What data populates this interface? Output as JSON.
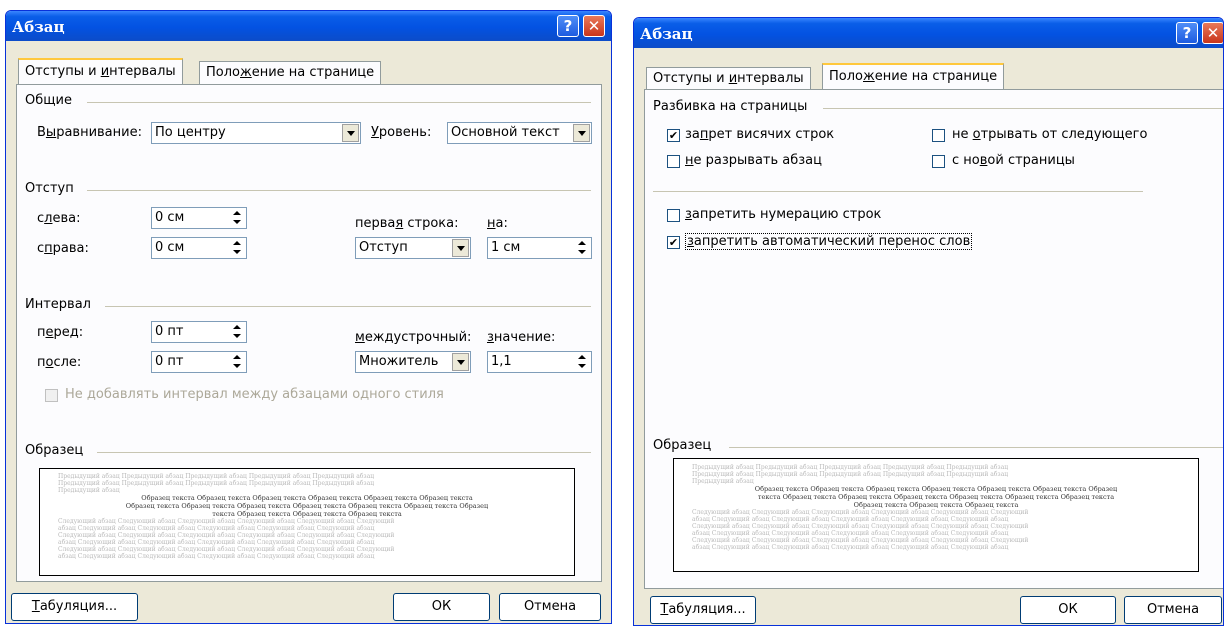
{
  "colors": {
    "titlebar": "#0352e2",
    "dialog_bg": "#ece9d8",
    "active_tab_highlight": "#ffc83c",
    "close_button": "#c8351b"
  },
  "dialog1": {
    "title": "Абзац",
    "help_button": "?",
    "close_button": "✕",
    "tabs": [
      {
        "pre": "Отступы и ",
        "accel": "и",
        "post": "нтервалы"
      },
      {
        "pre": "Поло",
        "accel": "ж",
        "post": "ение на странице"
      }
    ],
    "general": {
      "heading": "Общие",
      "align_label_pre": "В",
      "align_label_accel": "ы",
      "align_label_post": "равнивание:",
      "align_value": "По центру",
      "level_label_accel": "У",
      "level_label_post": "ровень:",
      "level_value": "Основной текст"
    },
    "indent": {
      "heading": "Отступ",
      "left_label_pre": "с",
      "left_label_accel": "л",
      "left_label_post": "ева:",
      "left_value": "0 см",
      "right_label_pre": "с",
      "right_label_accel": "п",
      "right_label_post": "рава:",
      "right_value": "0 см",
      "first_line_label_pre": "перва",
      "first_line_label_accel": "я",
      "first_line_label_post": " строка:",
      "first_line_value": "Отступ",
      "by_label_accel": "н",
      "by_label_post": "а:",
      "by_value": "1 см"
    },
    "spacing": {
      "heading": "Интервал",
      "before_label_pre": "п",
      "before_label_accel": "е",
      "before_label_post": "ред:",
      "before_value": "0 пт",
      "after_label_pre": "п",
      "after_label_accel": "о",
      "after_label_post": "сле:",
      "after_value": "0 пт",
      "line_label_accel": "м",
      "line_label_post": "еждустрочный:",
      "line_value": "Множитель",
      "at_label_accel": "з",
      "at_label_post": "начение:",
      "at_value": "1,1",
      "no_space_label": "Не добавлять интервал между абзацами одного стиля"
    },
    "preview": {
      "heading": "Образец",
      "prev_lines": [
        "Предыдущий абзац Предыдущий абзац Предыдущий абзац Предыдущий абзац Предыдущий абзац",
        "Предыдущий абзац Предыдущий абзац Предыдущий абзац Предыдущий абзац Предыдущий абзац",
        "Предыдущий абзац"
      ],
      "sample_lines": [
        "Образец текста Образец текста Образец текста Образец текста Образец текста Образец текста",
        "Образец текста Образец текста Образец текста Образец текста Образец текста Образец текста Образец",
        "текста Образец текста Образец текста Образец текста"
      ],
      "next_lines": [
        "Следующий абзац Следующий абзац Следующий абзац Следующий абзац Следующий абзац Следующий",
        "абзац Следующий абзац Следующий абзац Следующий абзац Следующий абзац Следующий абзац",
        "Следующий абзац Следующий абзац Следующий абзац Следующий абзац Следующий абзац Следующий",
        "абзац Следующий абзац Следующий абзац Следующий абзац Следующий абзац Следующий абзац",
        "Следующий абзац Следующий абзац Следующий абзац Следующий абзац Следующий абзац Следующий",
        "абзац Следующий абзац Следующий абзац Следующий абзац Следующий абзац Следующий абзац"
      ]
    },
    "buttons": {
      "tabs_accel": "Т",
      "tabs_post": "абуляция...",
      "ok": "ОК",
      "cancel": "Отмена"
    }
  },
  "dialog2": {
    "title": "Абзац",
    "help_button": "?",
    "close_button": "✕",
    "tabs": [
      {
        "pre": "Отступы и ",
        "accel": "и",
        "post": "нтервалы"
      },
      {
        "pre": "Поло",
        "accel": "ж",
        "post": "ение на странице"
      }
    ],
    "pagination": {
      "heading": "Разбивка на страницы",
      "widow_pre": "за",
      "widow_accel": "п",
      "widow_post": "рет висячих строк",
      "widow_checked": "✔",
      "keep_next_pre": "не ",
      "keep_next_accel": "о",
      "keep_next_post": "трывать от следующего",
      "keep_together_accel": "н",
      "keep_together_post": "е разрывать абзац",
      "page_break_pre": "с но",
      "page_break_accel": "в",
      "page_break_post": "ой страницы"
    },
    "suppress_line_numbers_accel": "з",
    "suppress_line_numbers_post": "апретить нумерацию строк",
    "no_hyphenation_accel": "з",
    "no_hyphenation_post": "апретить автоматический перенос слов",
    "no_hyphenation_checked": "✔",
    "preview": {
      "heading": "Образец",
      "prev_lines": [
        "Предыдущий абзац Предыдущий абзац Предыдущий абзац Предыдущий абзац Предыдущий абзац",
        "Предыдущий абзац Предыдущий абзац Предыдущий абзац Предыдущий абзац Предыдущий абзац",
        "Предыдущий абзац"
      ],
      "sample_lines": [
        "Образец текста Образец текста Образец текста Образец текста Образец текста Образец текста Образец",
        "текста Образец текста Образец текста Образец текста Образец текста Образец текста Образец текста",
        "Образец текста Образец текста Образец текста"
      ],
      "next_lines": [
        "Следующий абзац Следующий абзац Следующий абзац Следующий абзац Следующий абзац Следующий",
        "абзац Следующий абзац Следующий абзац Следующий абзац Следующий абзац Следующий абзац",
        "Следующий абзац Следующий абзац Следующий абзац Следующий абзац Следующий абзац Следующий",
        "абзац Следующий абзац Следующий абзац Следующий абзац Следующий абзац Следующий абзац",
        "Следующий абзац Следующий абзац Следующий абзац Следующий абзац Следующий абзац Следующий",
        "абзац Следующий абзац Следующий абзац Следующий абзац Следующий абзац Следующий абзац"
      ]
    },
    "buttons": {
      "tabs_accel": "Т",
      "tabs_post": "абуляция...",
      "ok": "ОК",
      "cancel": "Отмена"
    }
  }
}
